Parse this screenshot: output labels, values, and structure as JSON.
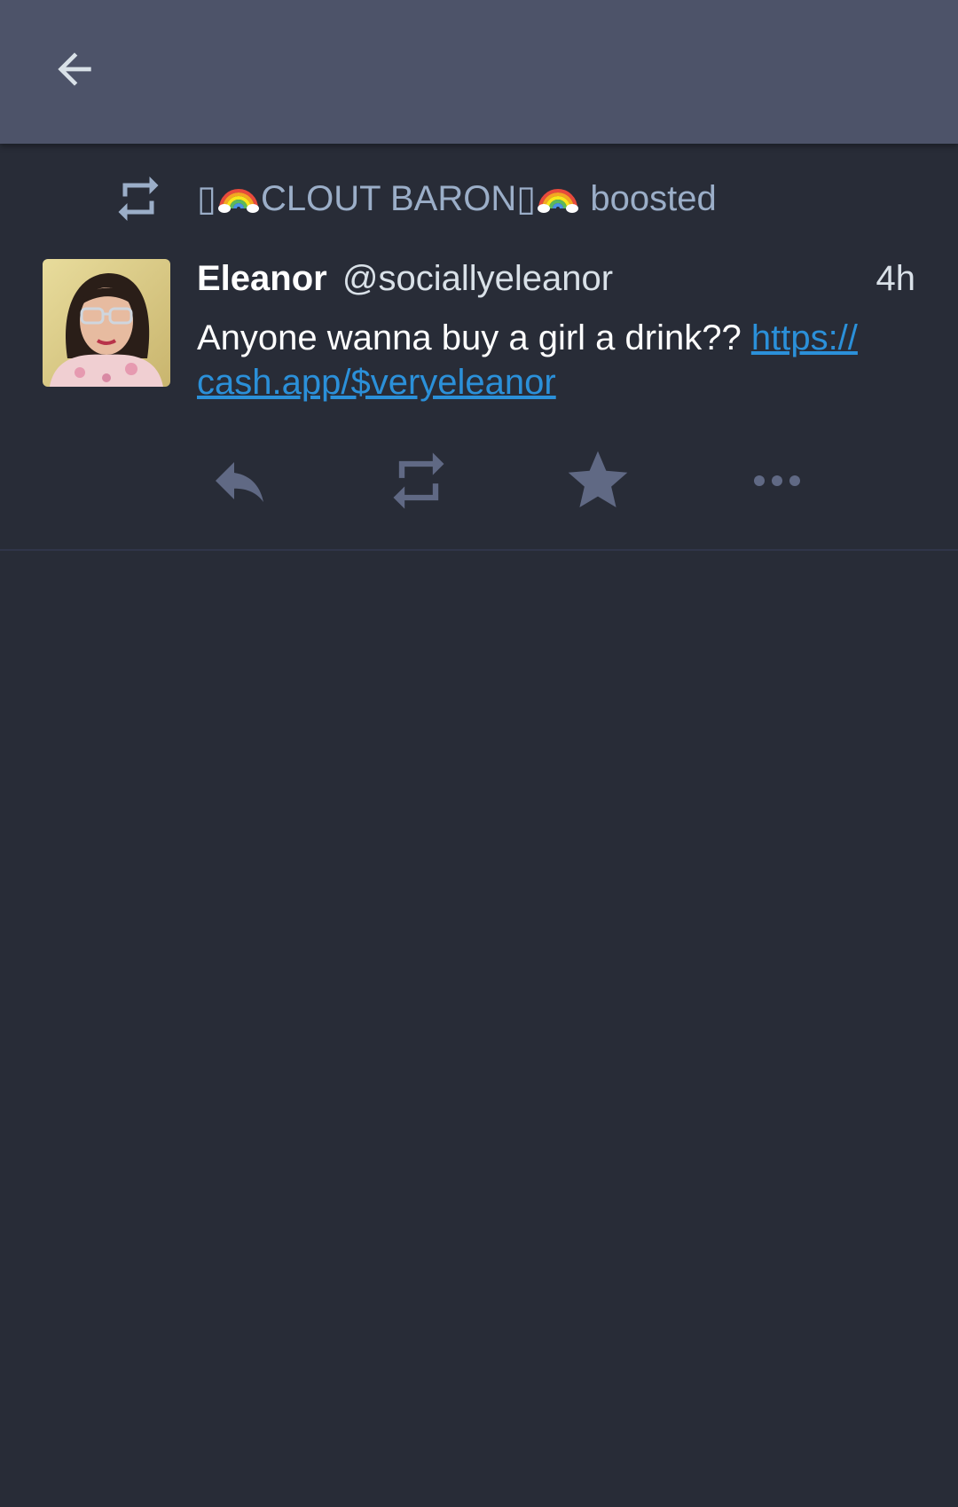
{
  "appbar": {
    "back_icon": "arrow-left-icon"
  },
  "status": {
    "booster_name": "CLOUT BARON",
    "booster_prefix_glyph": "▯",
    "booster_suffix_glyph": "▯",
    "boosted_label": "boosted",
    "display_name": "Eleanor",
    "acct": "@sociallyeleanor",
    "timestamp": "4h",
    "content_text": "Anyone wanna buy a girl a drink?? ",
    "link_line1": "https://",
    "link_line2": "cash.app/$veryeleanor",
    "avatar": "profile-photo"
  },
  "actions": {
    "reply_icon": "reply-icon",
    "boost_icon": "boost-icon",
    "favourite_icon": "star-icon",
    "more_icon": "more-icon"
  },
  "colors": {
    "appbar": "#4d5369",
    "background": "#282c37",
    "secondary_text": "#9baec8",
    "link": "#2b90d9",
    "action_icon": "#606984"
  }
}
